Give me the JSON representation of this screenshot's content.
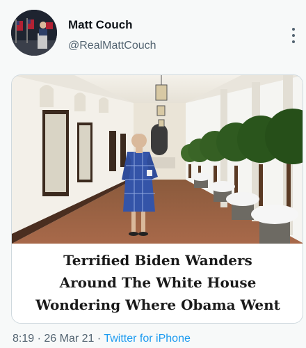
{
  "author": {
    "display_name": "Matt Couch",
    "handle": "@RealMattCouch",
    "avatar_icon": "profile-photo-podium"
  },
  "more_icon": "vertical-ellipsis-icon",
  "card": {
    "image_icon": "photo-man-in-robe-white-house-colonnade",
    "headline_lines": [
      "Terrified Biden Wanders",
      "Around The White House",
      "Wondering Where Obama Went"
    ]
  },
  "meta": {
    "time": "8:19",
    "separator": "·",
    "date": "26 Mar 21",
    "source": "Twitter for iPhone"
  },
  "colors": {
    "background": "#f7f9f9",
    "secondary_text": "#536471",
    "link": "#1d9bf0"
  }
}
